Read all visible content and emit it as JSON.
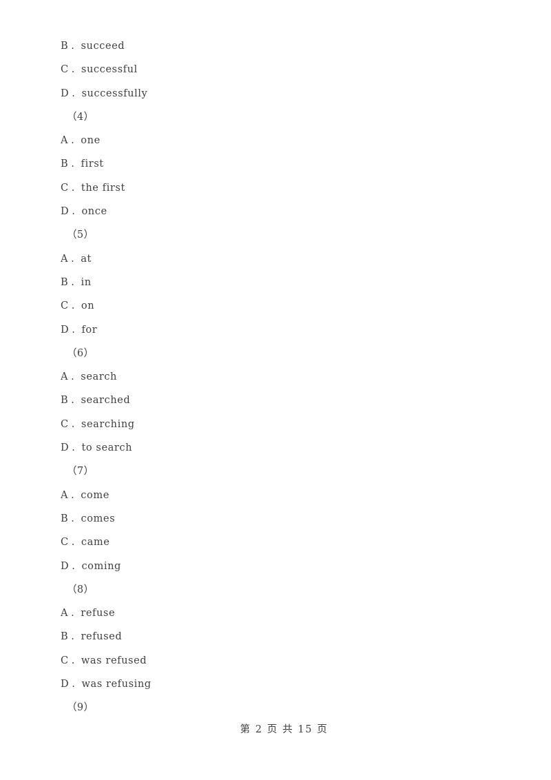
{
  "document": {
    "page_label": "第 2 页 共 15 页",
    "page_number": "2",
    "total_pages": "15",
    "text_color": "#3f3f3f",
    "background_color": "#ffffff"
  },
  "lines": [
    {
      "kind": "option",
      "letter": "B",
      "separator": ".",
      "text": "succeed"
    },
    {
      "kind": "option",
      "letter": "C",
      "separator": ".",
      "text": "successful"
    },
    {
      "kind": "option",
      "letter": "D",
      "separator": ".",
      "text": "successfully"
    },
    {
      "kind": "question",
      "text": "（4）"
    },
    {
      "kind": "option",
      "letter": "A",
      "separator": ".",
      "text": "one"
    },
    {
      "kind": "option",
      "letter": "B",
      "separator": ".",
      "text": "first"
    },
    {
      "kind": "option",
      "letter": "C",
      "separator": ".",
      "text": "the first"
    },
    {
      "kind": "option",
      "letter": "D",
      "separator": ".",
      "text": "once"
    },
    {
      "kind": "question",
      "text": "（5）"
    },
    {
      "kind": "option",
      "letter": "A",
      "separator": ".",
      "text": "at"
    },
    {
      "kind": "option",
      "letter": "B",
      "separator": ".",
      "text": "in"
    },
    {
      "kind": "option",
      "letter": "C",
      "separator": ".",
      "text": "on"
    },
    {
      "kind": "option",
      "letter": "D",
      "separator": ".",
      "text": "for"
    },
    {
      "kind": "question",
      "text": "（6）"
    },
    {
      "kind": "option",
      "letter": "A",
      "separator": ".",
      "text": "search"
    },
    {
      "kind": "option",
      "letter": "B",
      "separator": ".",
      "text": "searched"
    },
    {
      "kind": "option",
      "letter": "C",
      "separator": ".",
      "text": "searching"
    },
    {
      "kind": "option",
      "letter": "D",
      "separator": ".",
      "text": "to search"
    },
    {
      "kind": "question",
      "text": "（7）"
    },
    {
      "kind": "option",
      "letter": "A",
      "separator": ".",
      "text": "come"
    },
    {
      "kind": "option",
      "letter": "B",
      "separator": ".",
      "text": "comes"
    },
    {
      "kind": "option",
      "letter": "C",
      "separator": ".",
      "text": "came"
    },
    {
      "kind": "option",
      "letter": "D",
      "separator": ".",
      "text": "coming"
    },
    {
      "kind": "question",
      "text": "（8）"
    },
    {
      "kind": "option",
      "letter": "A",
      "separator": ".",
      "text": "refuse"
    },
    {
      "kind": "option",
      "letter": "B",
      "separator": ".",
      "text": "refused"
    },
    {
      "kind": "option",
      "letter": "C",
      "separator": ".",
      "text": "was refused"
    },
    {
      "kind": "option",
      "letter": "D",
      "separator": ".",
      "text": "was refusing"
    },
    {
      "kind": "question",
      "text": "（9）"
    }
  ]
}
